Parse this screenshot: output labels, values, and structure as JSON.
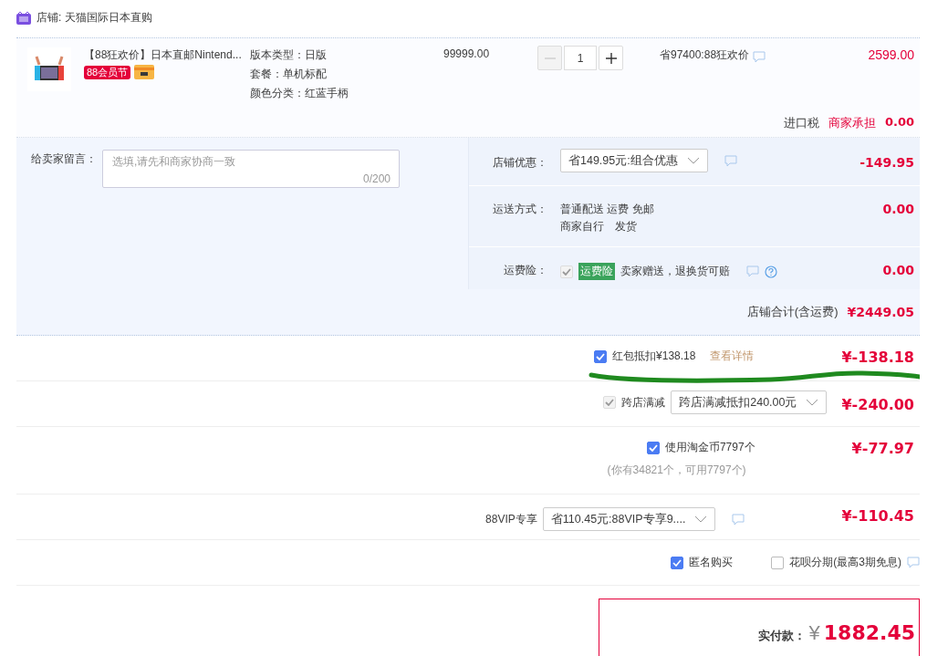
{
  "store": {
    "name": "店铺: 天猫国际日本直购"
  },
  "item": {
    "title": "【88狂欢价】日本直邮Nintend...",
    "badge": "88会员节",
    "specs": [
      "版本类型：日版",
      "套餐：单机标配",
      "颜色分类：红蓝手柄"
    ],
    "unit_price": "99999.00",
    "quantity": "1",
    "minus_disabled": true,
    "savings": "省97400:88狂欢价",
    "subtotal": "2599.00"
  },
  "import_tax": {
    "label": "进口税",
    "bearer": "商家承担",
    "amount": "0.00"
  },
  "message": {
    "label": "给卖家留言：",
    "placeholder": "选填,请先和商家协商一致",
    "counter": "0/200"
  },
  "store_discount": {
    "label": "店铺优惠：",
    "select": "省149.95元:组合优惠",
    "amount": "-149.95"
  },
  "shipping": {
    "label": "运送方式：",
    "lines": [
      "普通配送 运费 免邮",
      "商家自行　发货"
    ],
    "amount": "0.00"
  },
  "insurance": {
    "label": "运费险：",
    "checked": true,
    "disabled": true,
    "tag": "运费险",
    "text": "卖家赠送，退换货可赔",
    "amount": "0.00"
  },
  "store_total": {
    "label": "店铺合计(含运费)",
    "amount": "¥2449.05"
  },
  "adjustments": [
    {
      "kind": "check",
      "checked": true,
      "disabled": false,
      "label": "红包抵扣¥138.18",
      "link": "查看详情",
      "amount": "¥-138.18"
    },
    {
      "kind": "check_select",
      "checked": true,
      "disabled": true,
      "label": "跨店满减",
      "select": "跨店满减抵扣240.00元",
      "amount": "¥-240.00"
    },
    {
      "kind": "check",
      "checked": true,
      "disabled": false,
      "label": "使用淘金币7797个",
      "note": "(你有34821个，可用7797个)",
      "amount": "¥-77.97"
    },
    {
      "kind": "select",
      "label": "88VIP专享",
      "select": "省110.45元:88VIP专享9....",
      "amount": "¥-110.45"
    }
  ],
  "options": [
    {
      "label": "匿名购买",
      "checked": true
    },
    {
      "label": "花呗分期(最高3期免息)",
      "checked": false
    }
  ],
  "payment": {
    "label": "实付款：",
    "currency": "¥",
    "amount": "1882.45"
  }
}
